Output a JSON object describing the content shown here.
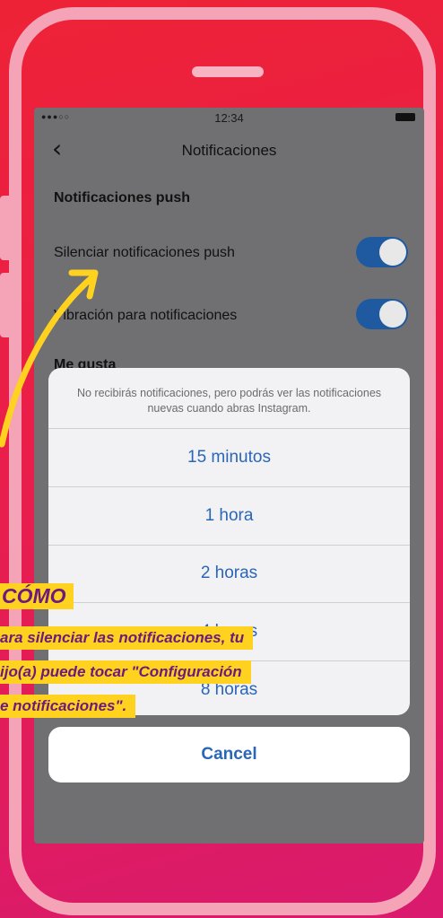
{
  "status_bar": {
    "signal": "●●●○○",
    "time": "12:34"
  },
  "nav": {
    "back_icon": "‹",
    "title": "Notificaciones"
  },
  "settings": {
    "section_push": "Notificaciones push",
    "row_mute": "Silenciar notificaciones push",
    "row_mute_on": true,
    "row_vibration": "Vibración para notificaciones",
    "row_vibration_on": true,
    "section_likes": "Me gusta"
  },
  "action_sheet": {
    "message": "No recibirás notificaciones, pero podrás ver las notificaciones nuevas cuando abras Instagram.",
    "options": [
      "15 minutos",
      "1 hora",
      "2 horas",
      "4 horas",
      "8 horas"
    ],
    "cancel": "Cancel"
  },
  "callout": {
    "title": "CÓMO",
    "lines": [
      "ara silenciar las notificaciones, tu",
      "ijo(a) puede tocar \"Configuración",
      "e notificaciones\"."
    ]
  },
  "colors": {
    "background": "#ee2236",
    "frame": "#f5a3b6",
    "callout_bg": "#ffd21f",
    "callout_text": "#6b1a7e",
    "ios_blue": "#2a66b8",
    "toggle_on": "#1f5aa0"
  }
}
